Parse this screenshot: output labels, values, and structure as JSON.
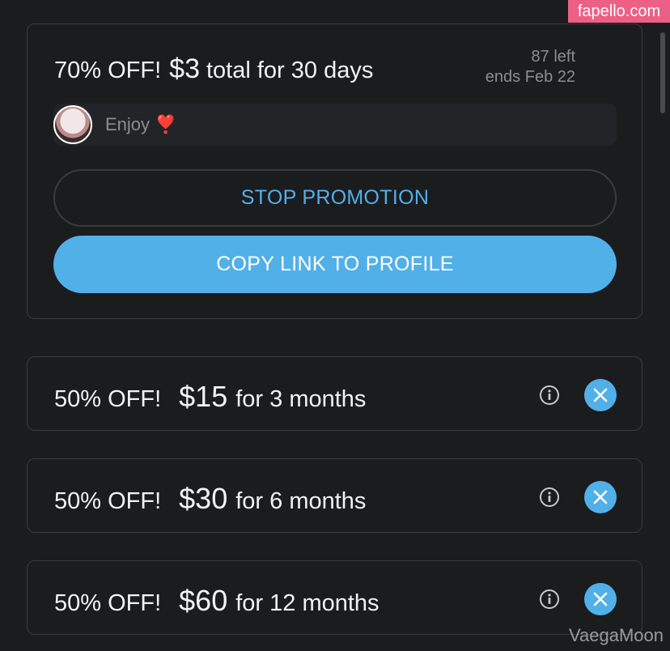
{
  "watermark": {
    "site": "fapello.com",
    "credit": "VaegaMoon"
  },
  "promotion": {
    "discount": "70% OFF!",
    "price": "$3",
    "terms": "total for 30 days",
    "left": "87 left",
    "ends": "ends Feb 22",
    "message": "Enjoy",
    "message_emoji": "❣️",
    "stop_label": "STOP PROMOTION",
    "copy_label": "COPY LINK TO PROFILE"
  },
  "offers": [
    {
      "discount": "50% OFF!",
      "price": "$15",
      "terms": "for 3 months"
    },
    {
      "discount": "50% OFF!",
      "price": "$30",
      "terms": "for 6 months"
    },
    {
      "discount": "50% OFF!",
      "price": "$60",
      "terms": "for 12 months"
    }
  ],
  "colors": {
    "accent": "#52b0e8",
    "background": "#1b1c1e",
    "border": "#3a3b3e",
    "muted": "#8c8d90",
    "watermark": "#ee5f86"
  }
}
